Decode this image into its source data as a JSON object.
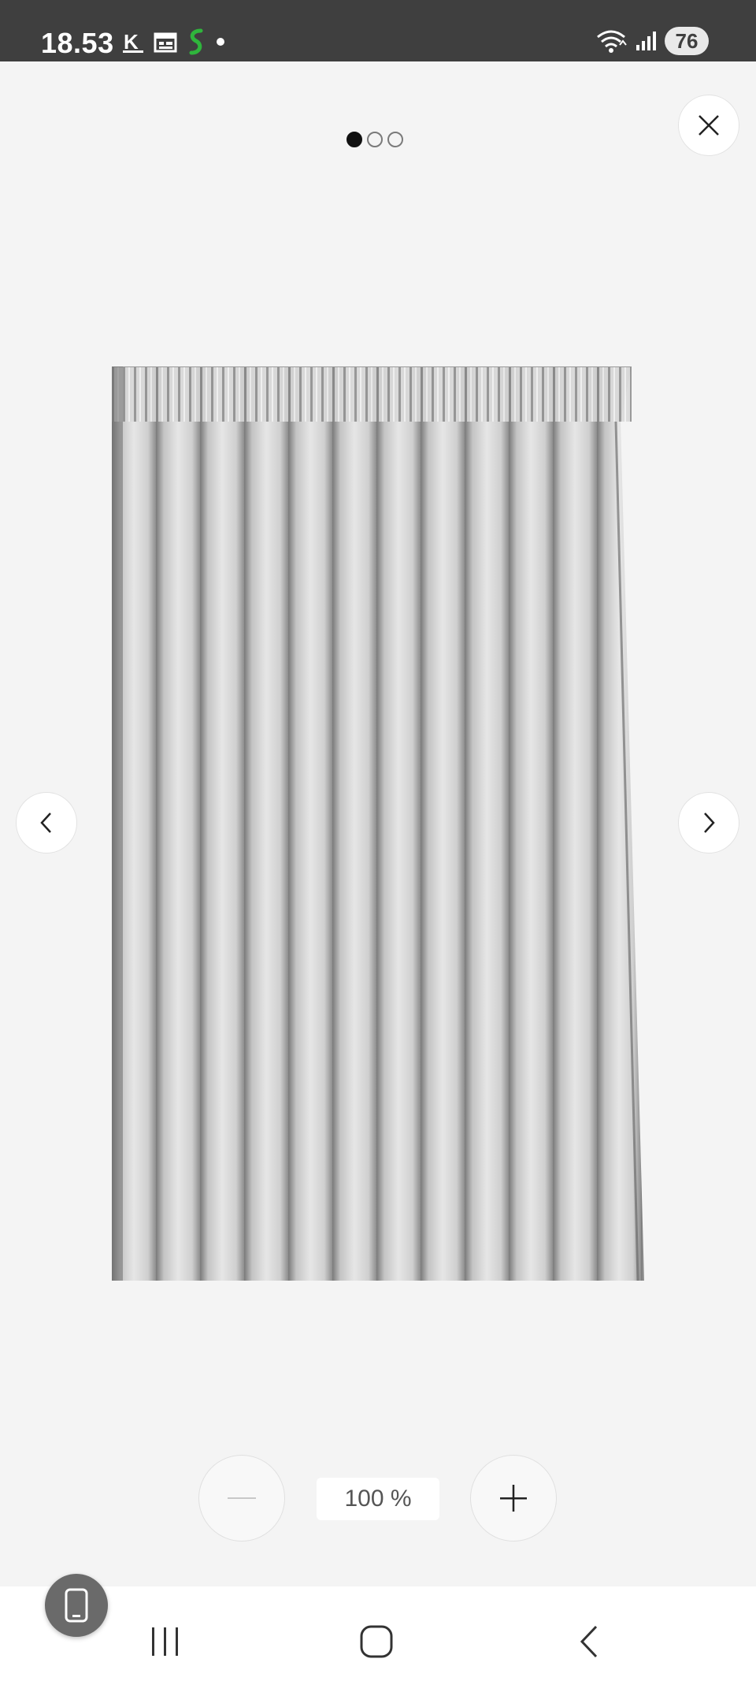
{
  "status_bar": {
    "time": "18.53",
    "battery": "76",
    "icons": [
      "k-app-icon",
      "calendar-icon",
      "s-app-icon",
      "notification-dot-icon",
      "wifi-icon",
      "signal-icon",
      "battery-icon"
    ]
  },
  "viewer": {
    "pager": {
      "count": 3,
      "active_index": 0
    },
    "image": {
      "subject": "gray pleated curtain panel"
    },
    "controls": {
      "close_icon": "close-icon",
      "prev_icon": "chevron-left-icon",
      "next_icon": "chevron-right-icon"
    }
  },
  "zoom": {
    "value": "100 %",
    "minus_icon": "minus-icon",
    "plus_icon": "plus-icon"
  },
  "nav_bar": {
    "icons": [
      "recent-apps-icon",
      "home-icon",
      "back-icon"
    ]
  },
  "colors": {
    "status_bar": "#3f3f3f",
    "background": "#f4f4f4",
    "curtain": "#cfcfcf"
  }
}
